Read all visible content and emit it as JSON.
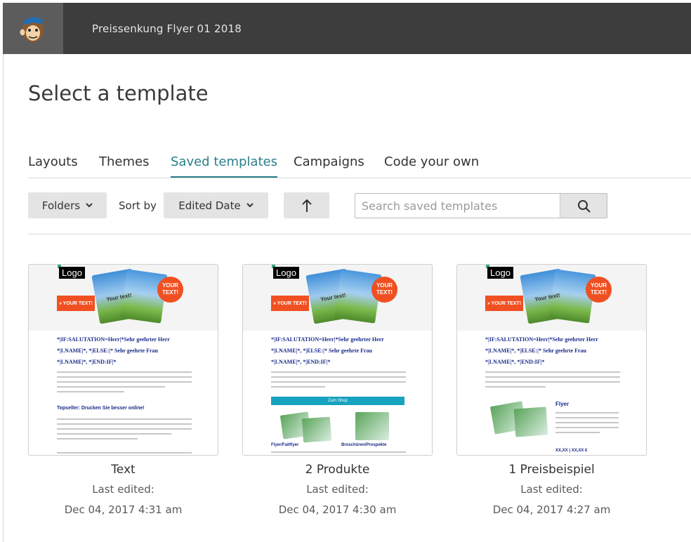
{
  "header": {
    "campaign_title": "Preissenkung Flyer 01 2018",
    "logo_icon": "freddie-monkey-logo-icon"
  },
  "page": {
    "title": "Select a template"
  },
  "tabs": [
    {
      "label": "Layouts",
      "active": false
    },
    {
      "label": "Themes",
      "active": false
    },
    {
      "label": "Saved templates",
      "active": true
    },
    {
      "label": "Campaigns",
      "active": false
    },
    {
      "label": "Code your own",
      "active": false
    }
  ],
  "filters": {
    "folders_label": "Folders",
    "sort_by_label": "Sort by",
    "sort_value": "Edited Date",
    "sort_direction_icon": "arrow-up-icon",
    "search_placeholder": "Search saved templates",
    "search_icon": "search-icon"
  },
  "preview": {
    "logo_text": "Logo",
    "cta_text": "» YOUR TEXT!",
    "badge_line1": "YOUR",
    "badge_line2": "TEXT!",
    "magazine_text": "Your text!",
    "merge_line1": "*|IF:SALUTATION=Herr|*Sehr geehrter Herr",
    "merge_line2": "*|LNAME|*, *|ELSE:|* Sehr geehrte Frau",
    "merge_line3": "*|LNAME|*, *|END:IF|*",
    "heading_text": "Topseller: Drucken Sie besser online!",
    "bar_text": "Zum Shop",
    "product1_label": "Flyer/Faltflyer",
    "product2_label": "Broschüren/Prospekte",
    "flyer_title": "Flyer",
    "price_text": "XX,XX | XX,XX €"
  },
  "templates": [
    {
      "name": "Text",
      "edited_label": "Last edited:",
      "edited_date": "Dec 04, 2017 4:31 am"
    },
    {
      "name": "2 Produkte",
      "edited_label": "Last edited:",
      "edited_date": "Dec 04, 2017 4:30 am"
    },
    {
      "name": "1 Preisbeispiel",
      "edited_label": "Last edited:",
      "edited_date": "Dec 04, 2017 4:27 am"
    }
  ],
  "colors": {
    "header_bg": "#3d3d3d",
    "accent_teal": "#2a7f8b",
    "preview_orange": "#f05021",
    "preview_blue": "#1a2a8a"
  }
}
